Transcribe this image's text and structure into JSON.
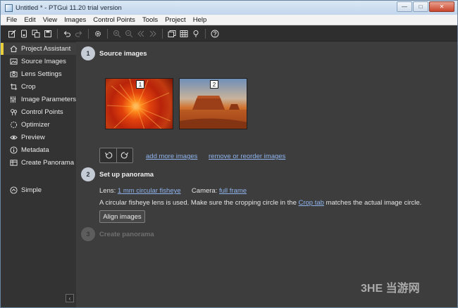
{
  "window": {
    "title": "Untitled * - PTGui 11.20 trial version",
    "caption_buttons": [
      "minimize",
      "maximize",
      "close"
    ]
  },
  "menu": [
    "File",
    "Edit",
    "View",
    "Images",
    "Control Points",
    "Tools",
    "Project",
    "Help"
  ],
  "toolbar": {
    "buttons": [
      "new-project-icon",
      "open-project-icon",
      "copy-icon",
      "save-icon",
      "undo-icon",
      "redo-icon",
      "settings-icon",
      "zoom-in-icon",
      "zoom-out-icon",
      "previous-icon",
      "next-icon",
      "panorama-editor-icon",
      "table-icon",
      "lightbulb-icon",
      "help-icon"
    ]
  },
  "sidebar": {
    "items": [
      {
        "label": "Project Assistant",
        "icon": "home-icon",
        "active": true
      },
      {
        "label": "Source Images",
        "icon": "image-icon"
      },
      {
        "label": "Lens Settings",
        "icon": "camera-icon"
      },
      {
        "label": "Crop",
        "icon": "crop-icon"
      },
      {
        "label": "Image Parameters",
        "icon": "sliders-icon"
      },
      {
        "label": "Control Points",
        "icon": "pins-icon"
      },
      {
        "label": "Optimizer",
        "icon": "optimizer-icon"
      },
      {
        "label": "Preview",
        "icon": "eye-icon"
      },
      {
        "label": "Metadata",
        "icon": "info-icon"
      },
      {
        "label": "Create Panorama",
        "icon": "panorama-icon"
      }
    ],
    "mode": {
      "label": "Simple",
      "icon": "chevron-up-circle-icon"
    },
    "collapse_glyph": "‹"
  },
  "steps": {
    "step1": {
      "number": "1",
      "title": "Source images",
      "images": [
        {
          "number": "1",
          "subject": "orange flower"
        },
        {
          "number": "2",
          "subject": "desert butte"
        }
      ],
      "add_link": "add more images",
      "remove_link": "remove or reorder images"
    },
    "step2": {
      "number": "2",
      "title": "Set up panorama",
      "lens_label": "Lens:",
      "lens_value": "1 mm circular fisheye",
      "camera_label": "Camera:",
      "camera_value": "full frame",
      "info_prefix": "A circular fisheye lens is used. Make sure the cropping circle in the ",
      "info_link": "Crop tab",
      "info_suffix": " matches the actual image circle.",
      "align_button": "Align images"
    },
    "step3": {
      "number": "3",
      "title": "Create panorama"
    }
  },
  "watermark": "3HE 当游网",
  "colors": {
    "accent": "#e8cf3b",
    "link": "#8eb3ec",
    "main_bg": "#3d3d3d",
    "sidebar_bg": "#333333"
  }
}
